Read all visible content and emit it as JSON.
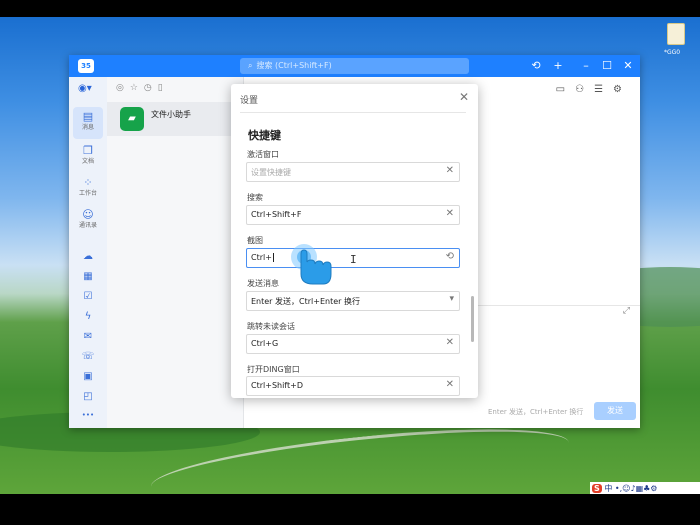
{
  "desktop": {
    "file_label": "*GG0"
  },
  "window": {
    "badge": "35",
    "search_placeholder": "搜索 (Ctrl+Shift+F)",
    "titlebar_buttons": [
      {
        "name": "history-icon",
        "glyph": "⟲"
      },
      {
        "name": "add-icon",
        "glyph": "+"
      },
      {
        "name": "minimize-icon",
        "glyph": "–"
      },
      {
        "name": "maximize-icon",
        "glyph": "☐"
      },
      {
        "name": "close-icon",
        "glyph": "✕"
      }
    ],
    "accent_color": "#1e80ff"
  },
  "sidebar": {
    "items": [
      {
        "label": "消息",
        "icon": "message-icon",
        "glyph": "▤"
      },
      {
        "label": "文档",
        "icon": "document-icon",
        "glyph": "❐"
      },
      {
        "label": "工作台",
        "icon": "workbench-icon",
        "glyph": "⁘"
      },
      {
        "label": "通讯录",
        "icon": "contacts-icon",
        "glyph": "☺"
      }
    ],
    "extra_icons": [
      {
        "icon": "cloud-icon",
        "glyph": "☁"
      },
      {
        "icon": "calendar-icon",
        "glyph": "▦"
      },
      {
        "icon": "todo-icon",
        "glyph": "☑"
      },
      {
        "icon": "ding-icon",
        "glyph": "ϟ"
      },
      {
        "icon": "mail-icon",
        "glyph": "✉"
      },
      {
        "icon": "phone-icon",
        "glyph": "☏"
      },
      {
        "icon": "meeting-icon",
        "glyph": "▣"
      },
      {
        "icon": "box-icon",
        "glyph": "◰"
      },
      {
        "icon": "more-icon",
        "glyph": "•••"
      }
    ]
  },
  "conversation_list": {
    "items": [
      {
        "name": "文件小助手",
        "avatar_glyph": "▰"
      }
    ]
  },
  "chat": {
    "send_hint": "Enter 发送，Ctrl+Enter 换行",
    "send_label": "发送"
  },
  "dialog": {
    "title": "设置",
    "section": "快捷键",
    "fields": [
      {
        "label": "激活窗口",
        "value": "",
        "placeholder": "设置快捷键",
        "action": "✕"
      },
      {
        "label": "搜索",
        "value": "Ctrl+Shift+F",
        "placeholder": "",
        "action": "✕"
      },
      {
        "label": "截图",
        "value": "Ctrl+",
        "placeholder": "",
        "action": "⟲"
      },
      {
        "label": "发送消息",
        "value": "Enter 发送，Ctrl+Enter 换行",
        "placeholder": "",
        "action": "▾"
      },
      {
        "label": "跳转未读会话",
        "value": "Ctrl+G",
        "placeholder": "",
        "action": "✕"
      },
      {
        "label": "打开DING窗口",
        "value": "Ctrl+Shift+D",
        "placeholder": "",
        "action": "✕"
      }
    ]
  },
  "ime_tray": {
    "brand": "S",
    "mode": "中"
  }
}
